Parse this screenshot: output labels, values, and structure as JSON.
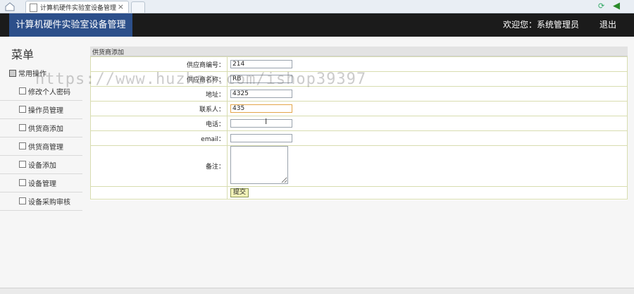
{
  "browser": {
    "tab_title": "计算机硬件实验室设备管理",
    "tab_close": "×",
    "icons": [
      "home-icon",
      "page-icon",
      "close-icon",
      "refresh-icon",
      "back-arrow-icon"
    ]
  },
  "header": {
    "brand": "计算机硬件实验室设备管理",
    "welcome": "欢迎您：系统管理员",
    "logout": "退出"
  },
  "sidebar": {
    "title": "菜单",
    "group": "常用操作",
    "items": [
      {
        "label": "修改个人密码"
      },
      {
        "label": "操作员管理"
      },
      {
        "label": "供货商添加"
      },
      {
        "label": "供货商管理"
      },
      {
        "label": "设备添加"
      },
      {
        "label": "设备管理"
      },
      {
        "label": "设备采购审核"
      }
    ]
  },
  "panel": {
    "title": "供货商添加"
  },
  "form": {
    "fields": [
      {
        "label": "供应商编号：",
        "value": "214"
      },
      {
        "label": "供应商名称：",
        "value": "RB"
      },
      {
        "label": "地址：",
        "value": "4325"
      },
      {
        "label": "联系人：",
        "value": "435"
      },
      {
        "label": "电话：",
        "value": ""
      },
      {
        "label": "email：",
        "value": ""
      },
      {
        "label": "备注：",
        "value": ""
      }
    ],
    "submit": "提交"
  },
  "watermark": "https://www.huzhan.com/ishop39397",
  "colors": {
    "header_bg": "#1b1b1b",
    "brand_bg": "#2c4f8a",
    "focus_border": "#e3a64a"
  }
}
